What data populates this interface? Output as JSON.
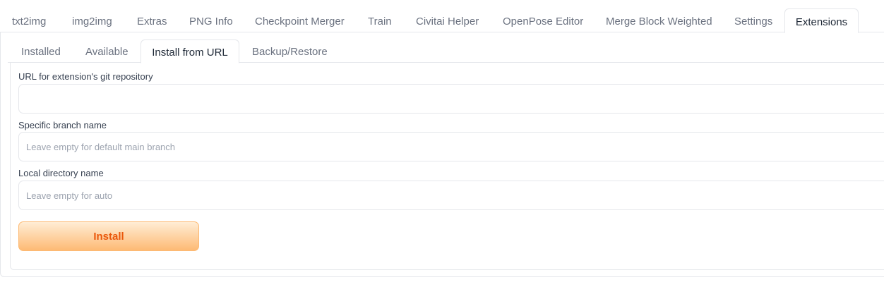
{
  "top_tabs": [
    "txt2img",
    "img2img",
    "Extras",
    "PNG Info",
    "Checkpoint Merger",
    "Train",
    "Civitai Helper",
    "OpenPose Editor",
    "Merge Block Weighted",
    "Settings",
    "Extensions"
  ],
  "top_tabs_active": "Extensions",
  "sub_tabs": [
    "Installed",
    "Available",
    "Install from URL",
    "Backup/Restore"
  ],
  "sub_tabs_active": "Install from URL",
  "form": {
    "url_label": "URL for extension's git repository",
    "url_value": "",
    "branch_label": "Specific branch name",
    "branch_placeholder": "Leave empty for default main branch",
    "dir_label": "Local directory name",
    "dir_placeholder": "Leave empty for auto",
    "install_label": "Install"
  },
  "colors": {
    "accent": "#ea580c",
    "button_gradient_start": "#ffedd5",
    "button_gradient_end": "#fdba74",
    "border": "#e5e7eb"
  }
}
